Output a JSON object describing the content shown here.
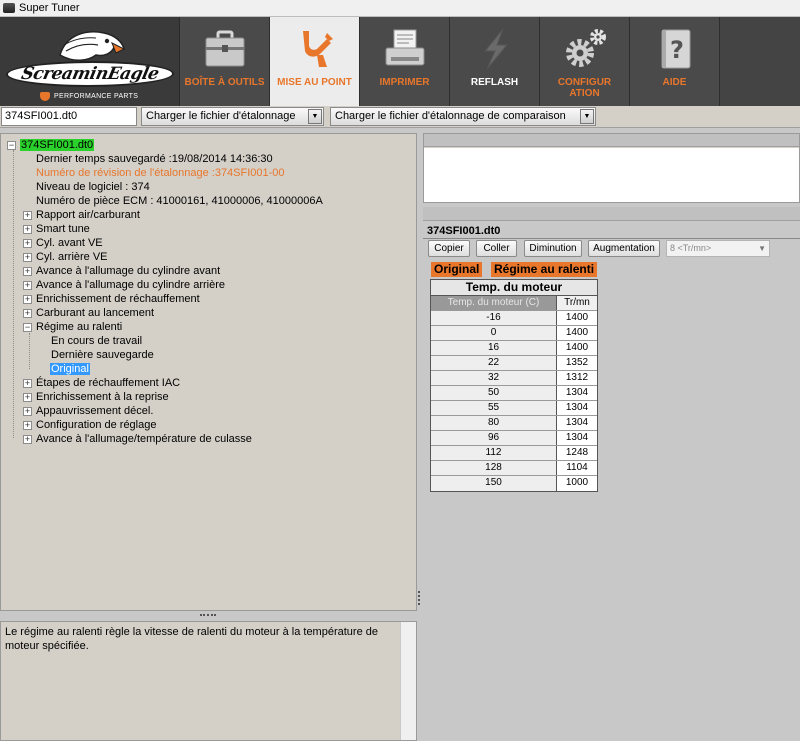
{
  "window": {
    "title": "Super Tuner"
  },
  "logo": {
    "brand": "ScreaminEagle",
    "tagline": "PERFORMANCE PARTS"
  },
  "toolbar": [
    {
      "id": "toolbox",
      "label": "BOÎTE À OUTILS",
      "icon": "toolbox-icon",
      "active": false
    },
    {
      "id": "tune",
      "label": "MISE AU POINT",
      "icon": "tuning-fork-icon",
      "active": true
    },
    {
      "id": "print",
      "label": "IMPRIMER",
      "icon": "printer-icon",
      "active": false
    },
    {
      "id": "reflash",
      "label": "REFLASH",
      "icon": "lightning-icon",
      "active": false
    },
    {
      "id": "config",
      "label": "CONFIGUR ATION",
      "icon": "gears-icon",
      "active": false
    },
    {
      "id": "help",
      "label": "AIDE",
      "icon": "help-book-icon",
      "active": false
    }
  ],
  "filebar": {
    "file_value": "374SFI001.dt0",
    "load_calibration": "Charger le fichier d'étalonnage",
    "load_compare": "Charger le fichier d'étalonnage de comparaison"
  },
  "tree": {
    "root": "374SFI001.dt0",
    "info": [
      "Dernier temps sauvegardé :19/08/2014 14:36:30",
      "Numéro de révision de l'étalonnage :374SFI001-00",
      "Niveau de logiciel : 374",
      "Numéro de pièce ECM : 41000161, 41000006, 41000006A"
    ],
    "groups_before": [
      "Rapport air/carburant",
      "Smart tune",
      "Cyl. avant VE",
      "Cyl. arrière VE",
      "Avance à l'allumage du cylindre avant",
      "Avance à l'allumage du cylindre arrière",
      "Enrichissement de réchauffement",
      "Carburant au lancement"
    ],
    "expanded_group": "Régime au ralenti",
    "expanded_children": [
      "En cours de travail",
      "Dernière sauvegarde",
      "Original"
    ],
    "groups_after": [
      "Étapes de réchauffement IAC",
      "Enrichissement à la reprise",
      "Appauvrissement décel.",
      "Configuration de réglage",
      "Avance à l'allumage/température de culasse"
    ]
  },
  "description": "Le régime au ralenti règle la vitesse de ralenti du moteur à la température de moteur spécifiée.",
  "editor": {
    "file_title": "374SFI001.dt0",
    "buttons": {
      "copy": "Copier",
      "paste": "Coller",
      "decrease": "Diminution",
      "increase": "Augmentation"
    },
    "unit_select": "8 <Tr/mn>",
    "tag_source": "Original",
    "tag_table": "Régime au ralenti",
    "table": {
      "caption": "Temp. du moteur",
      "col1": "Temp. du moteur (C)",
      "col2": "Tr/mn",
      "rows": [
        {
          "temp": "-16",
          "rpm": "1400"
        },
        {
          "temp": "0",
          "rpm": "1400"
        },
        {
          "temp": "16",
          "rpm": "1400"
        },
        {
          "temp": "22",
          "rpm": "1352"
        },
        {
          "temp": "32",
          "rpm": "1312"
        },
        {
          "temp": "50",
          "rpm": "1304"
        },
        {
          "temp": "55",
          "rpm": "1304"
        },
        {
          "temp": "80",
          "rpm": "1304"
        },
        {
          "temp": "96",
          "rpm": "1304"
        },
        {
          "temp": "112",
          "rpm": "1248"
        },
        {
          "temp": "128",
          "rpm": "1104"
        },
        {
          "temp": "150",
          "rpm": "1000"
        }
      ]
    }
  },
  "colors": {
    "accent": "#e8762b",
    "tree_root": "#2bd12b",
    "selection": "#3399ff",
    "toolbar_bg": "#444444"
  }
}
